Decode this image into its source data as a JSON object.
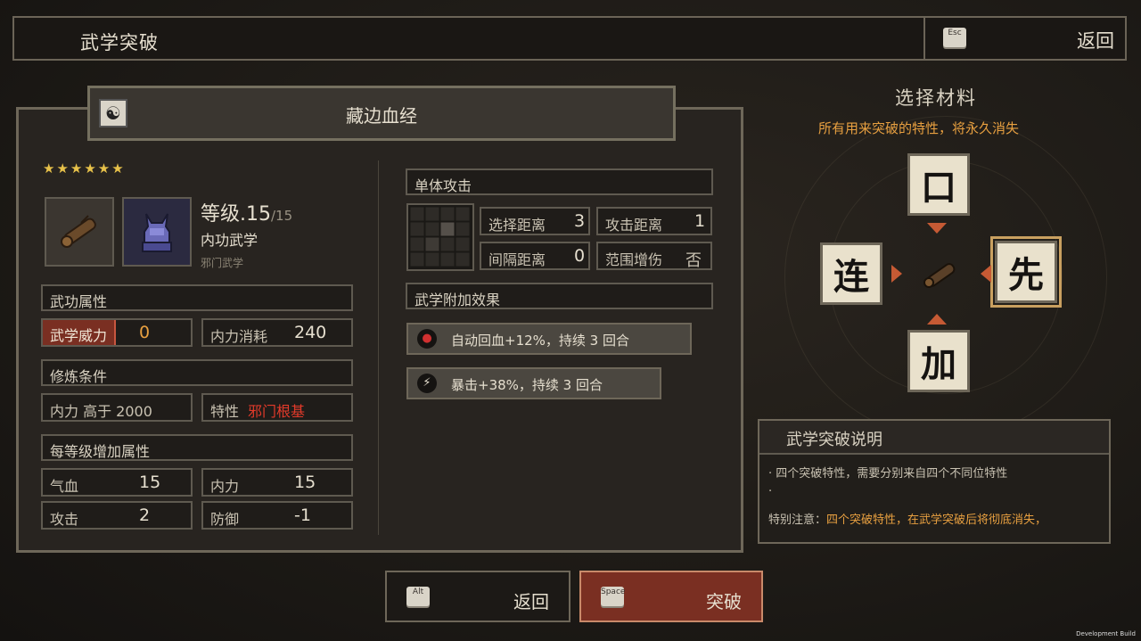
{
  "topbar": {
    "title": "武学突破",
    "esc_key": "Esc",
    "back_label": "返回"
  },
  "skill": {
    "name": "藏边血经",
    "stars": "★★★★★★",
    "level": "等级.15",
    "level_max": "/15",
    "type": "内功武学",
    "subtype": "邪门武学"
  },
  "attrs": {
    "section_title": "武功属性",
    "power_label": "武学威力",
    "power_value": "0",
    "mp_cost_label": "内力消耗",
    "mp_cost_value": "240"
  },
  "req": {
    "section_title": "修炼条件",
    "req_inner": "内力 高于 2000",
    "trait_label": "特性",
    "trait_value": "邪门根基"
  },
  "per_level": {
    "section_title": "每等级增加属性",
    "hp_label": "气血",
    "hp_value": "15",
    "mp_label": "内力",
    "mp_value": "15",
    "atk_label": "攻击",
    "atk_value": "2",
    "def_label": "防御",
    "def_value": "-1"
  },
  "attack": {
    "section_title": "单体攻击",
    "sel_range_label": "选择距离",
    "sel_range_value": "3",
    "atk_range_label": "攻击距离",
    "atk_range_value": "1",
    "gap_label": "间隔距离",
    "gap_value": "0",
    "area_label": "范围增伤",
    "area_value": "否"
  },
  "effects": {
    "section_title": "武学附加效果",
    "items": [
      {
        "icon": "blood-heal-icon",
        "text": "自动回血+12%，持续 3 回合"
      },
      {
        "icon": "lightning-icon",
        "text": "暴击+38%，持续 3 回合"
      }
    ]
  },
  "materials": {
    "title": "选择材料",
    "note": "所有用来突破的特性，将永久消失",
    "tiles": {
      "top": "口",
      "left": "连",
      "right": "先",
      "bottom": "加"
    }
  },
  "desc": {
    "title": "武学突破说明",
    "line1": "· 四个突破特性，需要分别来自四个不同位特性",
    "line2": "·",
    "line3_label": "特别注意：",
    "line3_text": "四个突破特性，在武学突破后将彻底消失，"
  },
  "buttons": {
    "back_key": "Alt",
    "back_label": "返回",
    "break_key": "Space",
    "break_label": "突破"
  },
  "footer": {
    "dev": "Development Build"
  },
  "colors": {
    "accent_red": "#7a2f22",
    "warning_orange": "#e8a040",
    "trait_red": "#e23a2a",
    "power_orange": "#e8a040"
  }
}
